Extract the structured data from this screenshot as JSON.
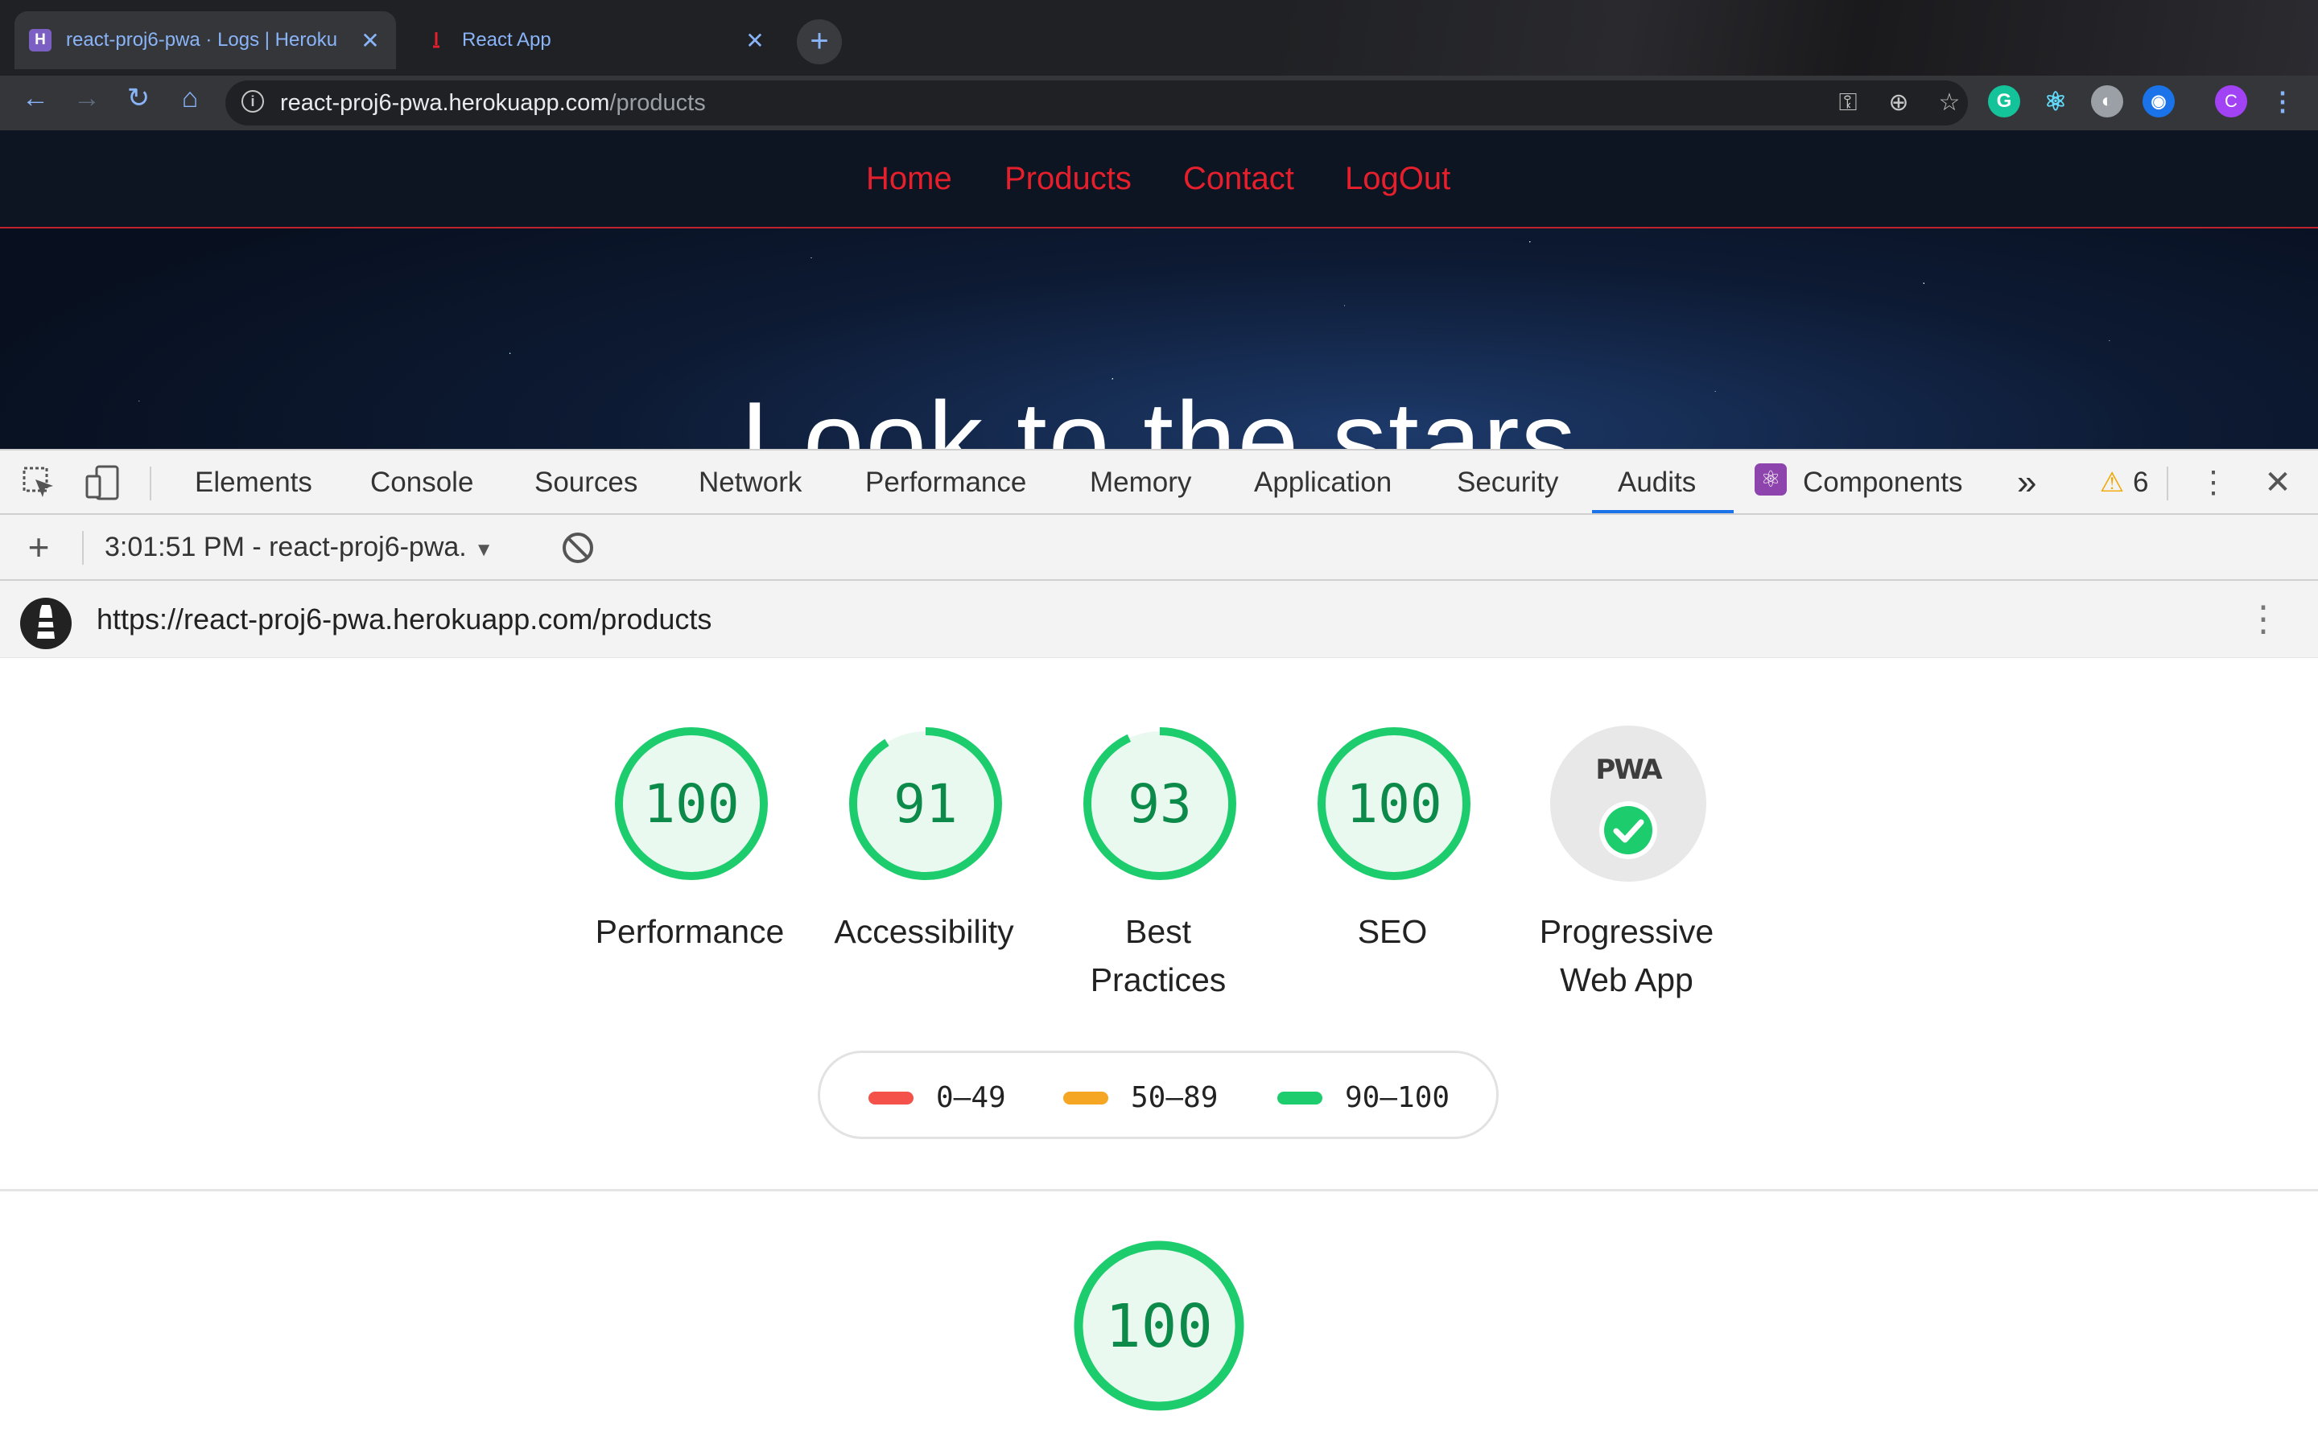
{
  "browser": {
    "tabs": [
      {
        "title": "react-proj6-pwa · Logs | Heroku",
        "favicon": "heroku-icon",
        "active": true
      },
      {
        "title": "React App",
        "favicon": "react-app-icon",
        "active": false
      }
    ],
    "new_tab_label": "+",
    "address": {
      "host": "react-proj6-pwa.herokuapp.com",
      "path": "/products"
    },
    "profile_initial": "C",
    "extensions": [
      "grammarly-icon",
      "react-devtools-icon",
      "extension-circle-icon",
      "eye-extension-icon"
    ]
  },
  "site": {
    "nav": [
      "Home",
      "Products",
      "Contact",
      "LogOut"
    ],
    "hero_text": "Look to the stars"
  },
  "devtools": {
    "tabs": [
      "Elements",
      "Console",
      "Sources",
      "Network",
      "Performance",
      "Memory",
      "Application",
      "Security",
      "Audits",
      "Components"
    ],
    "active_tab": "Audits",
    "more_tabs": "»",
    "warning_count": "6",
    "report_selector": "3:01:51 PM - react-proj6-pwa.",
    "report_url": "https://react-proj6-pwa.herokuapp.com/products"
  },
  "report": {
    "categories": [
      {
        "label_lines": [
          "Performance"
        ],
        "score": 100
      },
      {
        "label_lines": [
          "Accessibility"
        ],
        "score": 91
      },
      {
        "label_lines": [
          "Best",
          "Practices"
        ],
        "score": 93
      },
      {
        "label_lines": [
          "SEO"
        ],
        "score": 100
      },
      {
        "label_lines": [
          "Progressive",
          "Web App"
        ],
        "badge": "PWA",
        "status": "pass"
      }
    ],
    "legend": [
      {
        "range": "0–49",
        "color": "#f4514a"
      },
      {
        "range": "50–89",
        "color": "#f5a623"
      },
      {
        "range": "90–100",
        "color": "#1dcd6d"
      }
    ],
    "performance_score": 100,
    "colors": {
      "pass": "#1dcd6d",
      "pass_fill": "#eaf9f0",
      "pass_text": "#0c8a4a",
      "pwa_bg": "#e8e8e8"
    }
  }
}
